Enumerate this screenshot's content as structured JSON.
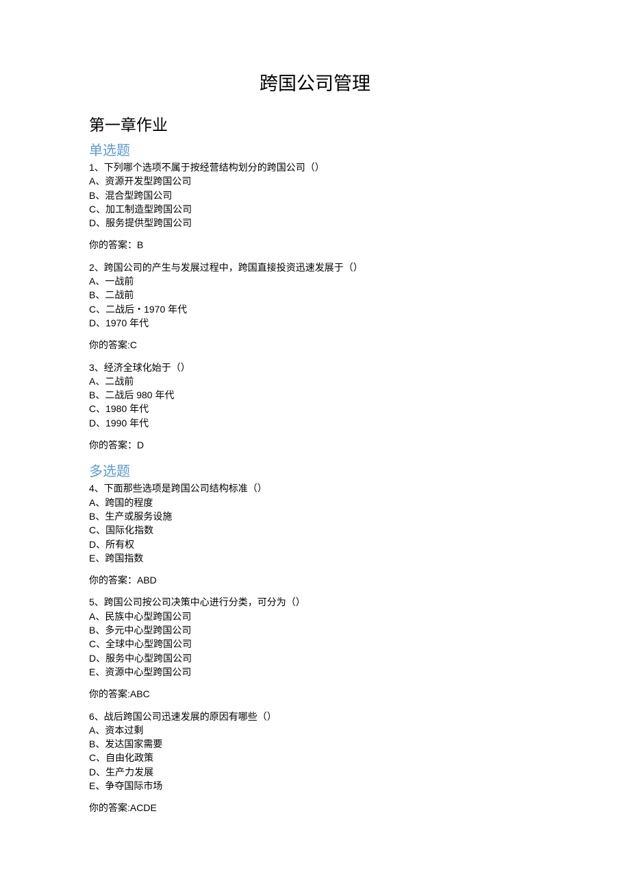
{
  "title": "跨国公司管理",
  "chapter": "第一章作业",
  "section_single": "单选题",
  "section_multi": "多选题",
  "q1": {
    "text": "1、下列哪个选项不属于按经营结构划分的跨国公司（）",
    "a": "A、资源开发型跨国公司",
    "b": "B、混合型跨国公司",
    "c": "C、加工制造型跨国公司",
    "d": "D、服务提供型跨国公司",
    "ans": "你的答案：B"
  },
  "q2": {
    "text": "2、跨国公司的产生与发展过程中，跨国直接投资迅速发展于（）",
    "a": "A、一战前",
    "b": "B、二战前",
    "c": "C、二战后・1970 年代",
    "d": "D、1970 年代",
    "ans": "你的答案:C"
  },
  "q3": {
    "text": "3、经济全球化始于（）",
    "a": "A、二战前",
    "b": "B、二战后 980 年代",
    "c": "C、1980 年代",
    "d": "D、1990 年代",
    "ans": "你的答案：D"
  },
  "q4": {
    "text": "4、下面那些选项是跨国公司结构标准（）",
    "a": "A、跨国的程度",
    "b": "B、生产或服务设施",
    "c": "C、国际化指数",
    "d": "D、所有权",
    "e": "E、跨国指数",
    "ans": "你的答案：ABD"
  },
  "q5": {
    "text": "5、跨国公司按公司决策中心进行分类，可分为（）",
    "a": "A、民族中心型跨国公司",
    "b": "B、多元中心型跨国公司",
    "c": "C、全球中心型跨国公司",
    "d": "D、服务中心型跨国公司",
    "e": "E、资源中心型跨国公司",
    "ans": "你的答案:ABC"
  },
  "q6": {
    "text": "6、战后跨国公司迅速发展的原因有哪些（）",
    "a": "A、资本过剩",
    "b": "B、发达国家需要",
    "c": "C、自由化政策",
    "d": "D、生产力发展",
    "e": "E、争夺国际市场",
    "ans": "你的答案:ACDE"
  }
}
